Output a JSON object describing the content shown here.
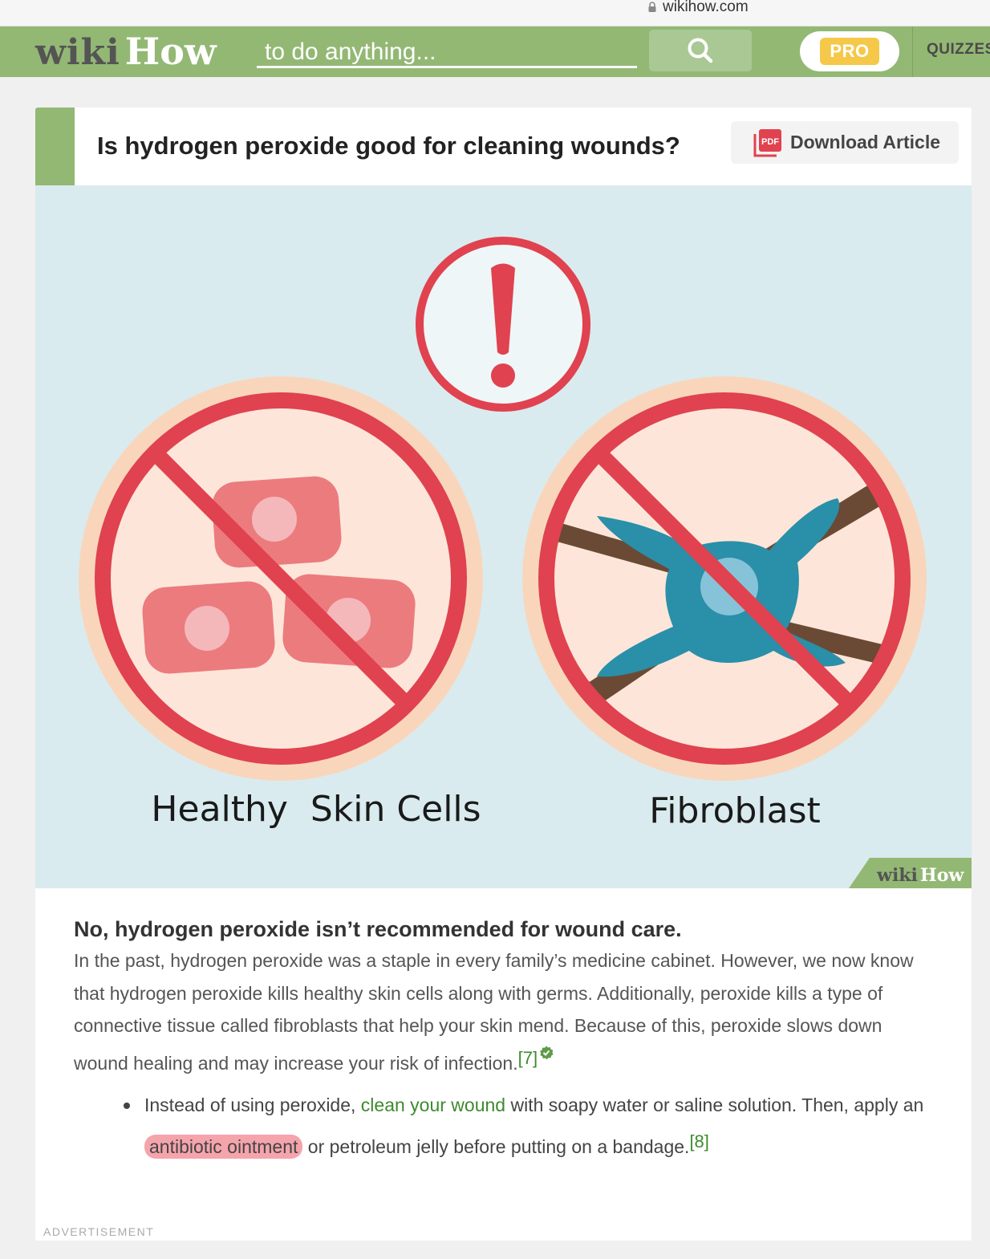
{
  "browser": {
    "url": "wikihow.com"
  },
  "header": {
    "logo_part1": "wiki",
    "logo_part2": "How",
    "search_placeholder": "to do anything...",
    "pro_label": "PRO",
    "quizzes_label": "QUIZZES"
  },
  "article": {
    "title": "Is hydrogen peroxide good for cleaning wounds?",
    "download_label": "Download Article",
    "pdf_icon_text": "PDF",
    "illustration": {
      "left_caption": "Healthy  Skin Cells",
      "right_caption": "Fibroblast",
      "watermark_part1": "wiki",
      "watermark_part2": "How"
    },
    "answer_heading": "No, hydrogen peroxide isn’t recommended for wound care.",
    "answer_body": "In the past, hydrogen peroxide was a staple in every family’s medicine cabinet. However, we now know that hydrogen peroxide kills healthy skin cells along with germs. Additionally, peroxide kills a type of connective tissue called fibroblasts that help your skin mend. Because of this, peroxide slows down wound healing and may increase your risk of infection.",
    "answer_citation": "[7]",
    "bullet": {
      "part1": "Instead of using peroxide, ",
      "link_text": "clean your wound",
      "part2": " with soapy water or saline solution. Then, apply an ",
      "highlight_text": "antibiotic ointment",
      "part3": " or petroleum jelly before putting on a bandage.",
      "citation": "[8]"
    },
    "advertisement_label": "ADVERTISEMENT"
  },
  "colors": {
    "brand_green": "#93b874",
    "link_green": "#3d8a2e",
    "warning_red": "#e0424f",
    "pro_yellow": "#f5c84a",
    "highlight_pink": "#f5a4ac"
  }
}
